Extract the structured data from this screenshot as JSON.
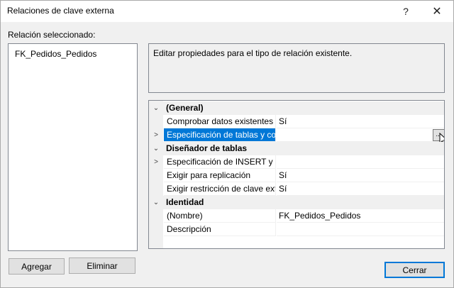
{
  "window": {
    "title": "Relaciones de clave externa",
    "help_glyph": "?",
    "close_glyph": "✕"
  },
  "selection": {
    "label": "Relación seleccionado:",
    "items": [
      "FK_Pedidos_Pedidos"
    ]
  },
  "description": "Editar propiedades para el tipo de relación existente.",
  "grid": {
    "rows": [
      {
        "kind": "category",
        "expander": "⌄",
        "name": "(General)"
      },
      {
        "kind": "property",
        "expander": "",
        "name": "Comprobar datos existentes a",
        "value": "Sí"
      },
      {
        "kind": "property",
        "expander": ">",
        "name": "Especificación de tablas y colu",
        "value": "",
        "selected": true
      },
      {
        "kind": "category",
        "expander": "⌄",
        "name": "Diseñador de tablas"
      },
      {
        "kind": "property",
        "expander": ">",
        "name": "Especificación de INSERT y UP",
        "value": ""
      },
      {
        "kind": "property",
        "expander": "",
        "name": "Exigir para replicación",
        "value": "Sí"
      },
      {
        "kind": "property",
        "expander": "",
        "name": "Exigir restricción de clave exte",
        "value": "Sí"
      },
      {
        "kind": "category",
        "expander": "⌄",
        "name": "Identidad"
      },
      {
        "kind": "property",
        "expander": "",
        "name": "(Nombre)",
        "value": "FK_Pedidos_Pedidos"
      },
      {
        "kind": "property",
        "expander": "",
        "name": "Descripción",
        "value": ""
      }
    ],
    "ellipsis_label": "..."
  },
  "buttons": {
    "add": "Agregar",
    "delete": "Eliminar",
    "close": "Cerrar"
  },
  "colors": {
    "selection": "#0078d7",
    "dialog_bg": "#f0f0f0"
  }
}
